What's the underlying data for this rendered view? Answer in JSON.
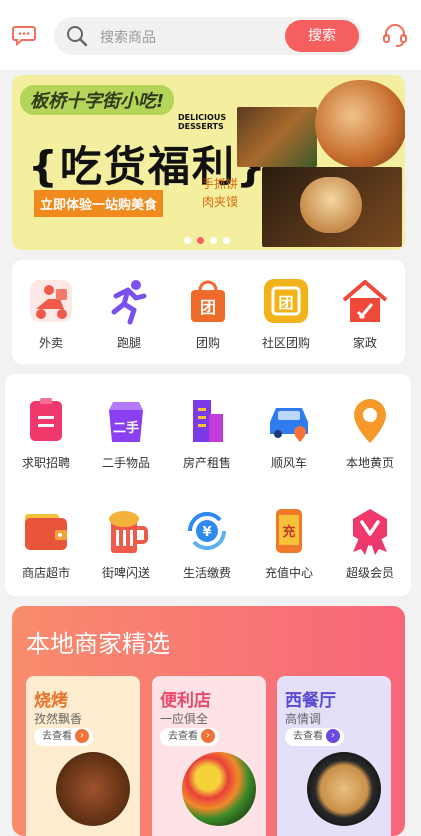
{
  "header": {
    "search_placeholder": "搜索商品",
    "search_button": "搜索"
  },
  "banner": {
    "title": "板桥十字街小吃!",
    "headline": "{吃货福利}",
    "subline": "立即体验一站购美食",
    "handwritten_1": "手抓饼",
    "handwritten_2": "肉夹馍",
    "deli_1": "DELICIOUS",
    "deli_2": "DESSERTS",
    "dots_total": 4,
    "dots_active": 2
  },
  "quick": [
    {
      "label": "外卖",
      "icon": "delivery-scooter-icon",
      "color": "#f05a4a"
    },
    {
      "label": "跑腿",
      "icon": "running-man-icon",
      "color": "#7b4ff0"
    },
    {
      "label": "团购",
      "icon": "group-buy-bag-icon",
      "color": "#f06a2a"
    },
    {
      "label": "社区团购",
      "icon": "community-group-buy-icon",
      "color": "#f2b21a"
    },
    {
      "label": "家政",
      "icon": "housekeeping-icon",
      "color": "#f0483a"
    }
  ],
  "services": [
    {
      "label": "求职招聘",
      "icon": "job-icon"
    },
    {
      "label": "二手物品",
      "icon": "second-hand-icon"
    },
    {
      "label": "房产租售",
      "icon": "real-estate-icon"
    },
    {
      "label": "顺风车",
      "icon": "car-icon"
    },
    {
      "label": "本地黄页",
      "icon": "location-pin-icon"
    },
    {
      "label": "商店超市",
      "icon": "wallet-icon"
    },
    {
      "label": "街啤闪送",
      "icon": "beer-icon"
    },
    {
      "label": "生活缴费",
      "icon": "yuan-payment-icon"
    },
    {
      "label": "充值中心",
      "icon": "recharge-phone-icon"
    },
    {
      "label": "超级会员",
      "icon": "vip-badge-icon"
    }
  ],
  "local": {
    "title": "本地商家精选",
    "cards": [
      {
        "title": "烧烤",
        "desc": "孜然飘香",
        "go": "去查看",
        "title_color": "#e9722a",
        "arrow_color": "#f0743a"
      },
      {
        "title": "便利店",
        "desc": "一应俱全",
        "go": "去查看",
        "title_color": "#e94a6a",
        "arrow_color": "#f0743a"
      },
      {
        "title": "西餐厅",
        "desc": "高情调",
        "go": "去查看",
        "title_color": "#5a4ad0",
        "arrow_color": "#6a4ae0"
      }
    ]
  }
}
